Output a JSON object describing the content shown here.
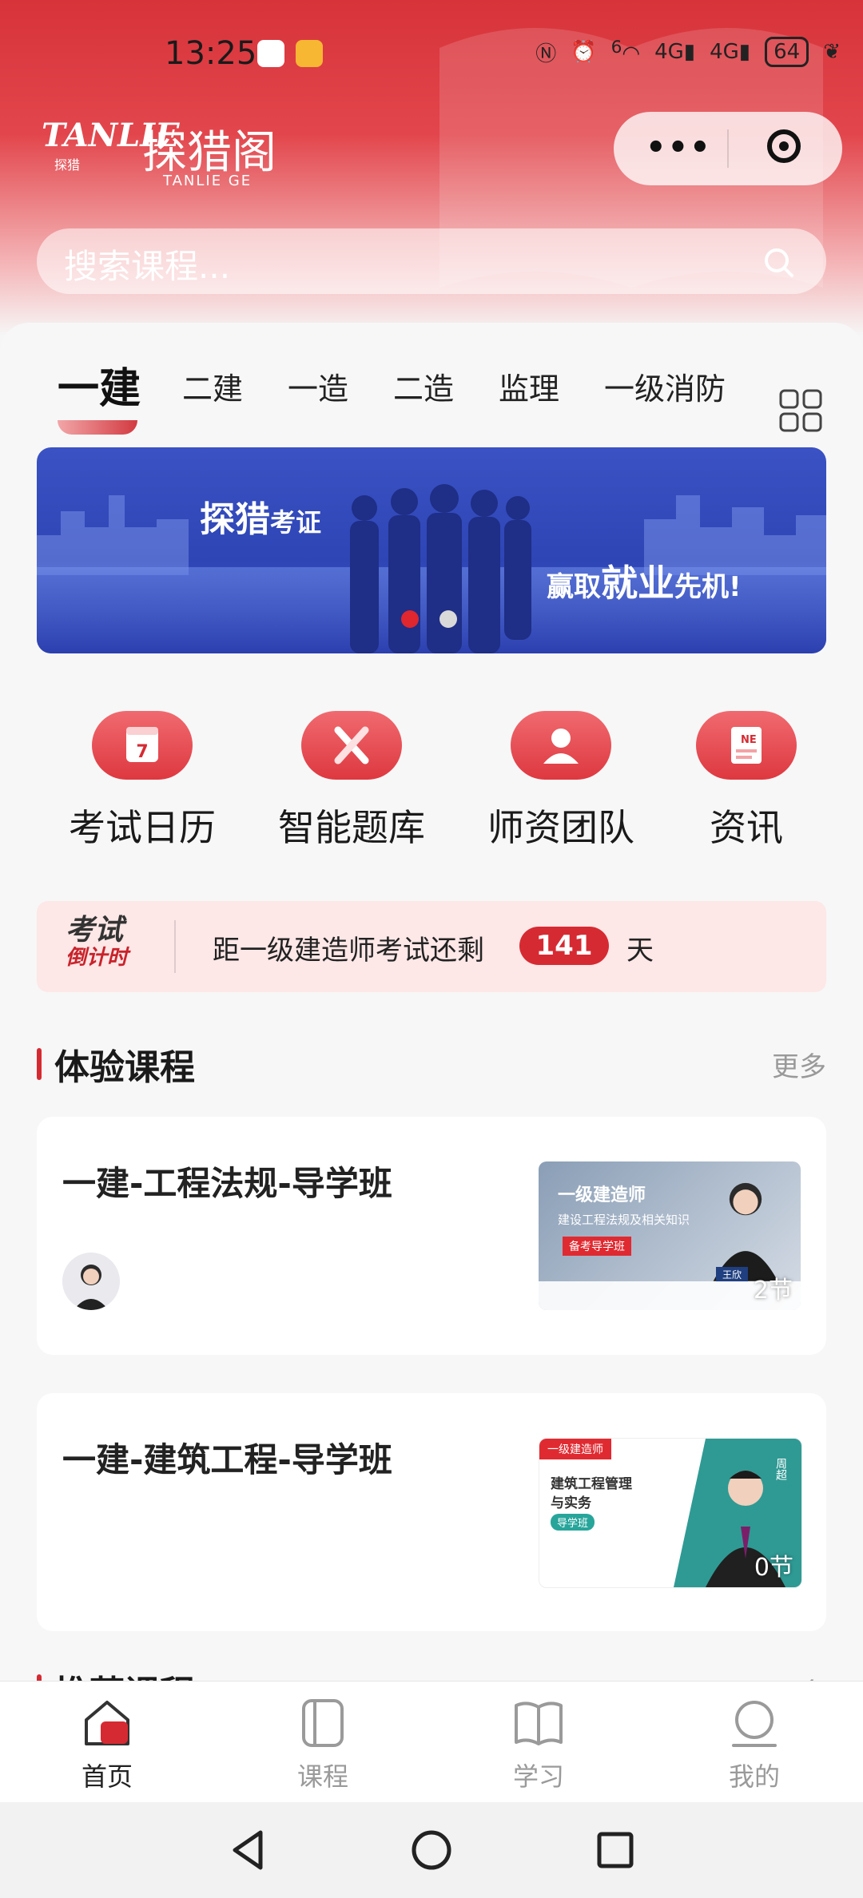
{
  "status_bar": {
    "time": "13:25",
    "battery": "64",
    "icons": [
      "nfc-icon",
      "alarm-icon",
      "wifi-6-icon",
      "signal-4g-icon",
      "signal-4g-icon",
      "leaf-icon"
    ],
    "signal_labels": [
      "4G",
      "4G"
    ],
    "wifi_label": "6"
  },
  "header": {
    "logo_mark": "TANLIE",
    "logo_sub": "探猎",
    "logo_cn": "探猎阁",
    "logo_en": "TANLIE GE",
    "search_placeholder": "搜索课程..."
  },
  "category_tabs": [
    {
      "label": "一建",
      "active": true
    },
    {
      "label": "二建",
      "active": false
    },
    {
      "label": "一造",
      "active": false
    },
    {
      "label": "二造",
      "active": false
    },
    {
      "label": "监理",
      "active": false
    },
    {
      "label": "一级消防",
      "active": false
    }
  ],
  "banner": {
    "title_big": "探猎",
    "title_small": "考证",
    "slogan_pre": "赢取",
    "slogan_big": "就业",
    "slogan_post": "先机!",
    "slide_count": 2,
    "active_slide": 1,
    "colors": {
      "dot_active": "#e0262f",
      "dot_inactive": "#d9d9d9"
    }
  },
  "quick_entries": [
    {
      "label": "考试日历",
      "icon": "calendar-icon",
      "icon_text": "7"
    },
    {
      "label": "智能题库",
      "icon": "pencil-ruler-icon"
    },
    {
      "label": "师资团队",
      "icon": "teacher-icon"
    },
    {
      "label": "资讯",
      "icon": "news-icon",
      "icon_text": "NE"
    }
  ],
  "countdown": {
    "logo_top": "考试",
    "logo_bottom": "倒计时",
    "text": "距一级建造师考试还剩",
    "days": "141",
    "unit": "天"
  },
  "section_trial": {
    "title": "体验课程",
    "more": "更多"
  },
  "courses": [
    {
      "title": "一建-工程法规-导学班",
      "lessons": "2节",
      "thumb": {
        "line1": "一级建造师",
        "line2": "建设工程法规及相关知识",
        "badge": "备考导学班",
        "teacher": "王欣"
      }
    },
    {
      "title": "一建-建筑工程-导学班",
      "lessons": "0节",
      "thumb": {
        "tag": "一级建造师",
        "line1": "建筑工程管理",
        "line2": "与实务",
        "badge": "导学班",
        "teacher": "周超"
      }
    }
  ],
  "section_recommend": {
    "title": "推荐课程",
    "more": "更多"
  },
  "tabbar": [
    {
      "label": "首页",
      "icon": "home-icon",
      "active": true
    },
    {
      "label": "课程",
      "icon": "course-icon",
      "active": false
    },
    {
      "label": "学习",
      "icon": "book-open-icon",
      "active": false
    },
    {
      "label": "我的",
      "icon": "profile-icon",
      "active": false
    }
  ],
  "colors": {
    "brand": "#d62a32",
    "header_top": "#d7333a",
    "page_bg": "#f7f7f7"
  }
}
